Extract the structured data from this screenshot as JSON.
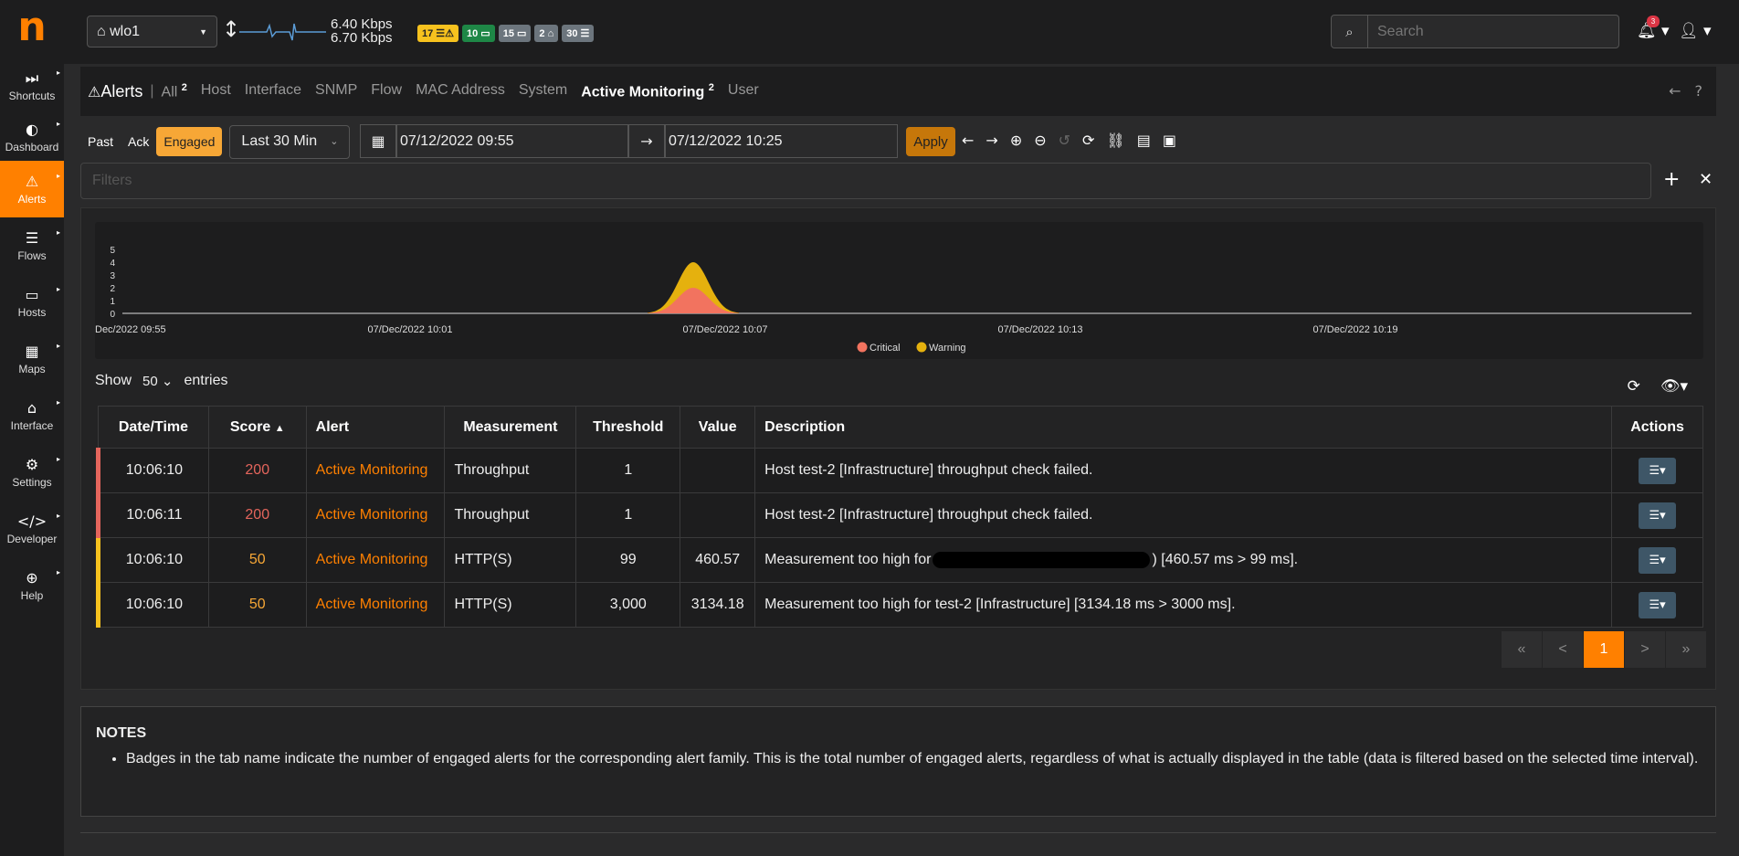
{
  "app": {
    "logo": "n"
  },
  "sidebar": {
    "items": [
      {
        "label": "Shortcuts",
        "icon": "⏭"
      },
      {
        "label": "Dashboard",
        "icon": "◐"
      },
      {
        "label": "Alerts",
        "icon": "⚠",
        "active": true
      },
      {
        "label": "Flows",
        "icon": "☰"
      },
      {
        "label": "Hosts",
        "icon": "▭"
      },
      {
        "label": "Maps",
        "icon": "▦"
      },
      {
        "label": "Interface",
        "icon": "⌂"
      },
      {
        "label": "Settings",
        "icon": "⚙"
      },
      {
        "label": "Developer",
        "icon": "</>"
      },
      {
        "label": "Help",
        "icon": "⊕"
      }
    ]
  },
  "topbar": {
    "interface": "wlo1",
    "upload": "6.40 Kbps",
    "download": "6.70 Kbps",
    "badges": [
      {
        "text": "17 ☰⚠",
        "color": "#f7c21e",
        "fg": "#222"
      },
      {
        "text": "10 ▭",
        "color": "#1e8746",
        "fg": "#fff"
      },
      {
        "text": "15 ▭",
        "color": "#6c757d",
        "fg": "#fff"
      },
      {
        "text": "2 ⌂",
        "color": "#6c757d",
        "fg": "#fff"
      },
      {
        "text": "30 ☰",
        "color": "#6c757d",
        "fg": "#fff"
      }
    ],
    "search_placeholder": "Search",
    "notifications": "3"
  },
  "tabs": {
    "title": "Alerts",
    "items": [
      {
        "label": "All",
        "badge": "2"
      },
      {
        "label": "Host",
        "badge": ""
      },
      {
        "label": "Interface",
        "badge": ""
      },
      {
        "label": "SNMP",
        "badge": ""
      },
      {
        "label": "Flow",
        "badge": ""
      },
      {
        "label": "MAC Address",
        "badge": ""
      },
      {
        "label": "System",
        "badge": ""
      },
      {
        "label": "Active Monitoring",
        "badge": "2",
        "active": true
      },
      {
        "label": "User",
        "badge": ""
      }
    ]
  },
  "toolbar": {
    "past": "Past",
    "ack": "Ack",
    "engaged": "Engaged",
    "range": "Last 30 Min",
    "from": "07/12/2022 09:55",
    "to": "07/12/2022 10:25",
    "apply": "Apply"
  },
  "filters": {
    "placeholder": "Filters"
  },
  "chart_data": {
    "type": "area",
    "x_labels": [
      "Dec/2022 09:55",
      "07/Dec/2022 10:01",
      "07/Dec/2022 10:07",
      "07/Dec/2022 10:13",
      "07/Dec/2022 10:19"
    ],
    "y_ticks": [
      "5",
      "4",
      "3",
      "2",
      "1",
      "0"
    ],
    "ylim": [
      0,
      5
    ],
    "series": [
      {
        "name": "Critical",
        "color": "#f2735f",
        "peak": 2
      },
      {
        "name": "Warning",
        "color": "#e5b10e",
        "peak": 2
      }
    ],
    "legend": "bottom"
  },
  "table": {
    "show": "Show",
    "entries_value": "50",
    "entries": "entries",
    "headers": [
      "Date/Time",
      "Score",
      "Alert",
      "Measurement",
      "Threshold",
      "Value",
      "Description",
      "Actions"
    ],
    "rows": [
      {
        "time": "10:06:10",
        "score": "200",
        "sev": "crit",
        "alert": "Active Monitoring",
        "measurement": "Throughput",
        "threshold": "1",
        "value": "",
        "description": "Host test-2 [Infrastructure] throughput check failed."
      },
      {
        "time": "10:06:11",
        "score": "200",
        "sev": "crit",
        "alert": "Active Monitoring",
        "measurement": "Throughput",
        "threshold": "1",
        "value": "",
        "description": "Host test-2 [Infrastructure] throughput check failed."
      },
      {
        "time": "10:06:10",
        "score": "50",
        "sev": "warn",
        "alert": "Active Monitoring",
        "measurement": "HTTP(S)",
        "threshold": "99",
        "value": "460.57",
        "description": "Measurement too high for",
        "description_tail": ") [460.57 ms > 99 ms].",
        "redacted": true
      },
      {
        "time": "10:06:10",
        "score": "50",
        "sev": "warn",
        "alert": "Active Monitoring",
        "measurement": "HTTP(S)",
        "threshold": "3,000",
        "value": "3134.18",
        "description": "Measurement too high for test-2 [Infrastructure] [3134.18 ms > 3000 ms]."
      }
    ],
    "pager": [
      "«",
      "<",
      "1",
      ">",
      "»"
    ]
  },
  "notes": {
    "title": "NOTES",
    "items": [
      "Badges in the tab name indicate the number of engaged alerts for the corresponding alert family. This is the total number of engaged alerts, regardless of what is actually displayed in the table (data is filtered based on the selected time interval)."
    ]
  }
}
